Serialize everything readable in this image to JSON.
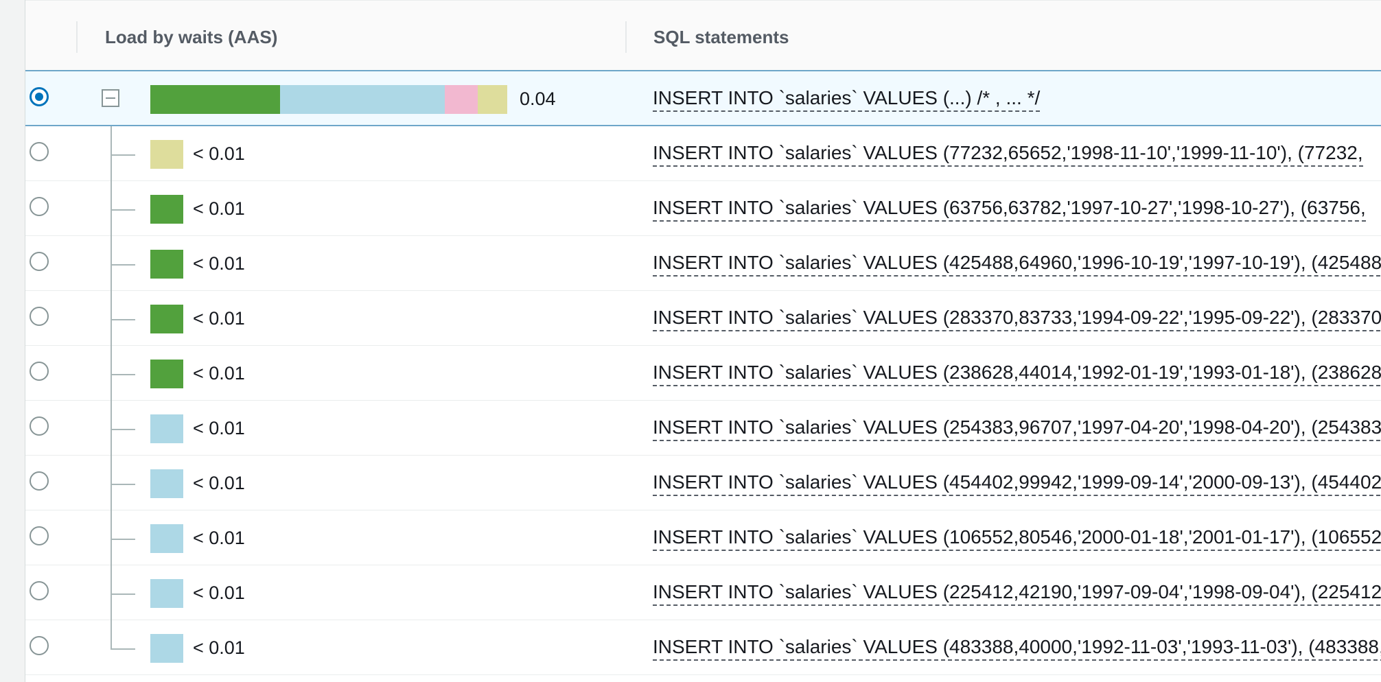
{
  "header": {
    "load_column": "Load by waits (AAS)",
    "sql_column": "SQL statements"
  },
  "colors": {
    "cpu": "#52a13d",
    "io": "#add8e6",
    "lock": "#f2b8d0",
    "other": "#dedd9c",
    "accent": "#0073bb"
  },
  "parent": {
    "selected": true,
    "load_value": "0.04",
    "load_breakdown": [
      {
        "color": "#52a13d",
        "fraction": 0.3627
      },
      {
        "color": "#add8e6",
        "fraction": 0.4608
      },
      {
        "color": "#f2b8d0",
        "fraction": 0.0931
      },
      {
        "color": "#dedd9c",
        "fraction": 0.0834
      }
    ],
    "sql": "INSERT INTO `salaries` VALUES (...) /* , ... */"
  },
  "children": [
    {
      "load_value": "< 0.01",
      "color": "#dedd9c",
      "sql": "INSERT INTO `salaries` VALUES (77232,65652,'1998-11-10','1999-11-10'), (77232,"
    },
    {
      "load_value": "< 0.01",
      "color": "#52a13d",
      "sql": "INSERT INTO `salaries` VALUES (63756,63782,'1997-10-27','1998-10-27'), (63756,"
    },
    {
      "load_value": "< 0.01",
      "color": "#52a13d",
      "sql": "INSERT INTO `salaries` VALUES (425488,64960,'1996-10-19','1997-10-19'), (425488,"
    },
    {
      "load_value": "< 0.01",
      "color": "#52a13d",
      "sql": "INSERT INTO `salaries` VALUES (283370,83733,'1994-09-22','1995-09-22'), (283370,"
    },
    {
      "load_value": "< 0.01",
      "color": "#52a13d",
      "sql": "INSERT INTO `salaries` VALUES (238628,44014,'1992-01-19','1993-01-18'), (238628,"
    },
    {
      "load_value": "< 0.01",
      "color": "#add8e6",
      "sql": "INSERT INTO `salaries` VALUES (254383,96707,'1997-04-20','1998-04-20'), (254383,"
    },
    {
      "load_value": "< 0.01",
      "color": "#add8e6",
      "sql": "INSERT INTO `salaries` VALUES (454402,99942,'1999-09-14','2000-09-13'), (454402,"
    },
    {
      "load_value": "< 0.01",
      "color": "#add8e6",
      "sql": "INSERT INTO `salaries` VALUES (106552,80546,'2000-01-18','2001-01-17'), (106552,"
    },
    {
      "load_value": "< 0.01",
      "color": "#add8e6",
      "sql": "INSERT INTO `salaries` VALUES (225412,42190,'1997-09-04','1998-09-04'), (225412,"
    },
    {
      "load_value": "< 0.01",
      "color": "#add8e6",
      "sql": "INSERT INTO `salaries` VALUES (483388,40000,'1992-11-03','1993-11-03'), (483388,"
    }
  ]
}
